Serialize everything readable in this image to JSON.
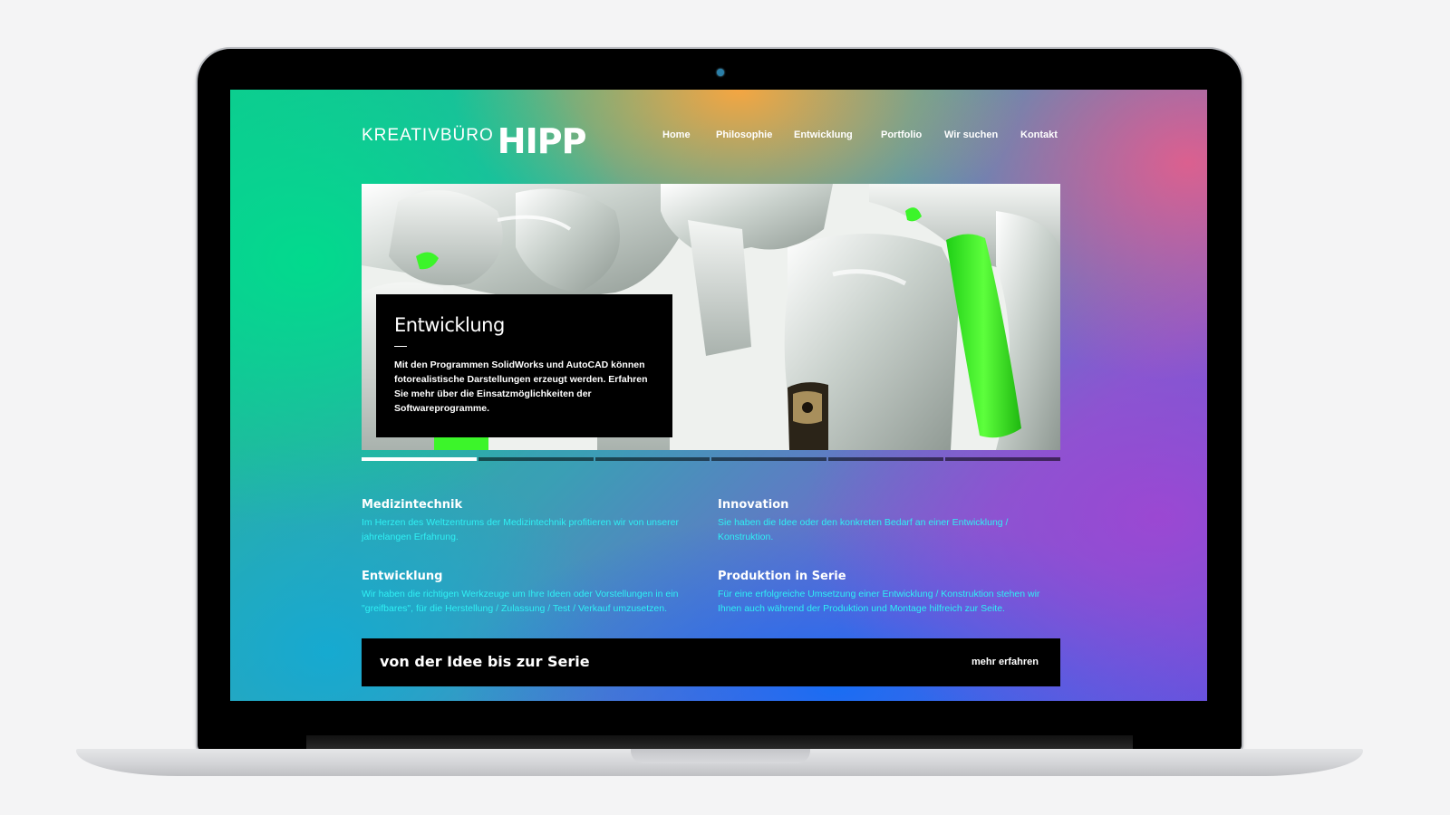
{
  "site": {
    "logo_light": "KREATIVBÜRO",
    "logo_bold": "HIPP"
  },
  "nav": {
    "items": [
      {
        "label": "Home",
        "active": true
      },
      {
        "label": "Philosophie",
        "active": false
      },
      {
        "label": "Entwicklung",
        "active": false
      },
      {
        "label": "Portfolio",
        "active": false
      },
      {
        "label": "Wir suchen",
        "active": false
      },
      {
        "label": "Kontakt",
        "active": false
      }
    ]
  },
  "hero": {
    "title": "Entwicklung",
    "text": "Mit den Programmen SolidWorks und AutoCAD können fotorealistische Darstellungen erzeugt werden. Erfahren Sie mehr über die Einsatzmöglichkeiten der Softwareprogramme.",
    "slides_total": 6,
    "active_slide": 1
  },
  "features": [
    {
      "title": "Medizintechnik",
      "text": "Im Herzen des Weltzentrums der Medizintechnik profitieren wir von unserer jahrelangen Erfahrung."
    },
    {
      "title": "Innovation",
      "text": "Sie haben die Idee oder den konkreten Bedarf an einer Entwicklung / Konstruktion."
    },
    {
      "title": "Entwicklung",
      "text": "Wir haben die richtigen Werkzeuge um Ihre Ideen oder Vorstellungen in ein \"greifbares\", für die Herstellung / Zulassung / Test / Verkauf umzusetzen."
    },
    {
      "title": "Produktion in Serie",
      "text": "Für eine erfolgreiche Umsetzung einer Entwicklung / Konstruktion stehen wir Ihnen auch während der Produktion und Montage hilfreich zur Seite."
    }
  ],
  "cta": {
    "title": "von der Idee bis zur Serie",
    "link": "mehr erfahren"
  },
  "colors": {
    "accent_text": "#2ff0f4",
    "implant_green": "#3cf52a"
  }
}
